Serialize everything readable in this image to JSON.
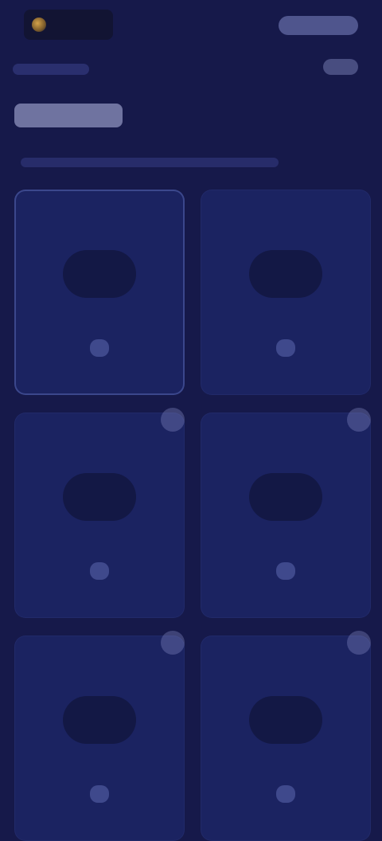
{
  "header": {
    "logo_icon": "logo-icon"
  },
  "cards": [
    {
      "label": "",
      "badge": false,
      "icon": "plan-icon"
    },
    {
      "label": "",
      "badge": false,
      "icon": "plan-icon"
    },
    {
      "label": "",
      "badge": true,
      "icon": "plan-icon"
    },
    {
      "label": "",
      "badge": true,
      "icon": "plan-icon"
    },
    {
      "label": "",
      "badge": true,
      "icon": "plan-icon"
    },
    {
      "label": "",
      "badge": true,
      "icon": "plan-icon"
    }
  ],
  "colors": {
    "background": "#16194a",
    "card": "#1b2361",
    "accent": "#b9bee8"
  }
}
